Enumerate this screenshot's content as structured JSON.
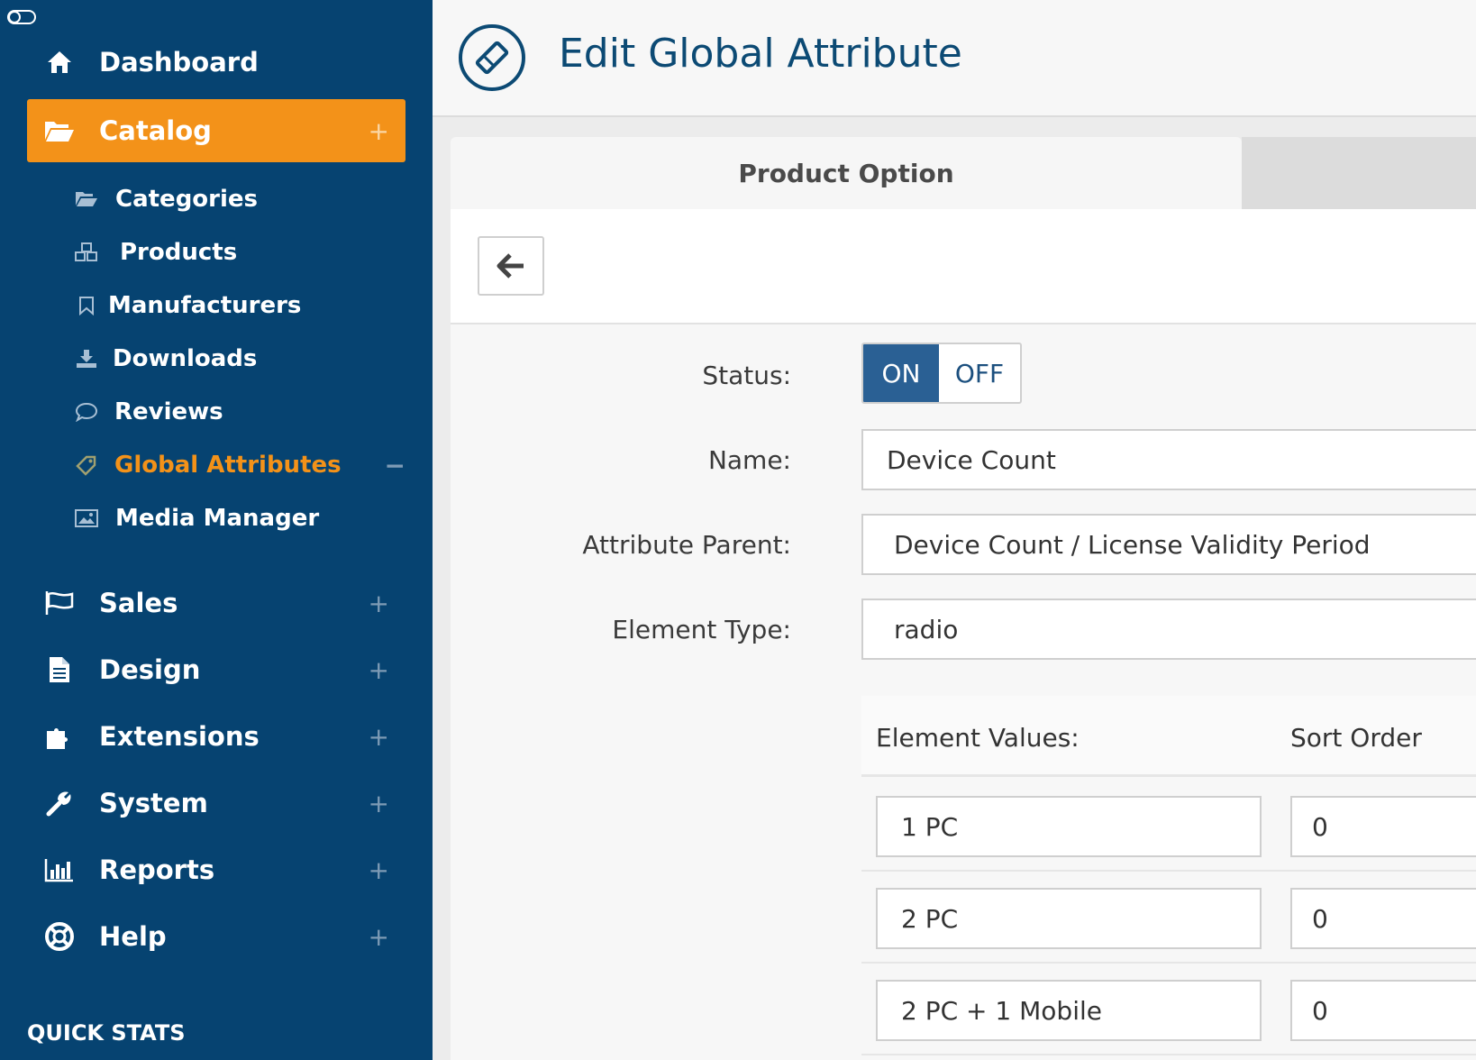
{
  "sidebar": {
    "main_items": [
      {
        "label": "Dashboard",
        "icon": "home-icon"
      },
      {
        "label": "Catalog",
        "icon": "folder-open-icon",
        "expand": "+"
      },
      {
        "label": "Sales",
        "icon": "flag-icon",
        "expand": "+"
      },
      {
        "label": "Design",
        "icon": "document-icon",
        "expand": "+"
      },
      {
        "label": "Extensions",
        "icon": "puzzle-icon",
        "expand": "+"
      },
      {
        "label": "System",
        "icon": "wrench-icon",
        "expand": "+"
      },
      {
        "label": "Reports",
        "icon": "bar-chart-icon",
        "expand": "+"
      },
      {
        "label": "Help",
        "icon": "lifebuoy-icon",
        "expand": "+"
      }
    ],
    "catalog_subitems": [
      {
        "label": "Categories",
        "icon": "folder-icon"
      },
      {
        "label": "Products",
        "icon": "cubes-icon"
      },
      {
        "label": "Manufacturers",
        "icon": "bookmark-icon"
      },
      {
        "label": "Downloads",
        "icon": "download-icon"
      },
      {
        "label": "Reviews",
        "icon": "comment-icon"
      },
      {
        "label": "Global Attributes",
        "icon": "tag-icon",
        "expand": "−"
      },
      {
        "label": "Media Manager",
        "icon": "image-icon"
      }
    ],
    "quick_stats": "QUICK STATS",
    "colors": {
      "background": "#064371",
      "active": "#f39219"
    }
  },
  "header": {
    "title": "Edit Global Attribute",
    "icon": "ticket-icon"
  },
  "tabs": {
    "active": "Product Option"
  },
  "form": {
    "status_label": "Status:",
    "status_on": "ON",
    "status_off": "OFF",
    "status_value": "ON",
    "name_label": "Name:",
    "name_value": "Device Count",
    "parent_label": "Attribute Parent:",
    "parent_value": "Device Count  /  License Validity Period",
    "type_label": "Element Type:",
    "type_value": "radio",
    "values_header": "Element Values:",
    "sort_header": "Sort Order",
    "values": [
      {
        "value": "1 PC",
        "sort": "0"
      },
      {
        "value": "2 PC",
        "sort": "0"
      },
      {
        "value": "2 PC + 1 Mobile",
        "sort": "0"
      }
    ]
  }
}
